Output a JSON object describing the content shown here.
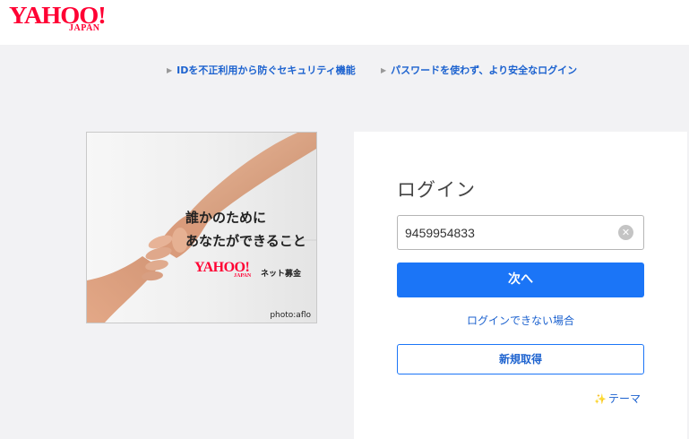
{
  "header": {
    "logo_text": "YAHOO!",
    "logo_sub": "JAPAN"
  },
  "security_links": [
    {
      "label": "IDを不正利用から防ぐセキュリティ機能",
      "icon": "triangle-right-icon"
    },
    {
      "label": "パスワードを使わず、より安全なログイン",
      "icon": "triangle-right-icon"
    }
  ],
  "ad": {
    "headline_line1": "誰かのために",
    "headline_line2": "あなたができること",
    "logo_text": "YAHOO!",
    "logo_sub": "JAPAN",
    "tagline": "ネット募金",
    "credit": "photo:aflo"
  },
  "login": {
    "title": "ログイン",
    "id_value": "9459954833",
    "clear_icon": "clear-circle-icon",
    "next_label": "次へ",
    "cannot_login_label": "ログインできない場合",
    "signup_label": "新規取得",
    "theme_label": "テーマ",
    "theme_icon": "sparkle-icon"
  },
  "colors": {
    "brand_red": "#ff0033",
    "primary_blue": "#1b75f7",
    "link_blue": "#1c62cf"
  }
}
